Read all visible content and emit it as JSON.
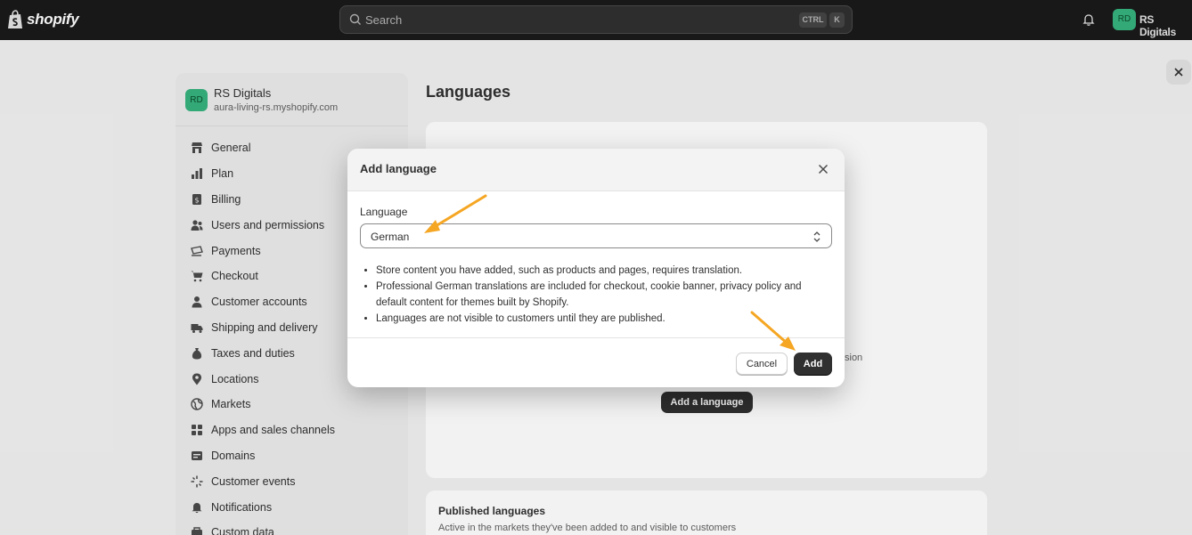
{
  "topbar": {
    "brand": "shopify",
    "search_placeholder": "Search",
    "shortcut_ctrl": "CTRL",
    "shortcut_key": "K",
    "avatar_initials": "RD",
    "store_name": "RS Digitals"
  },
  "sidebar": {
    "avatar_initials": "RD",
    "store_name": "RS Digitals",
    "store_domain": "aura-living-rs.myshopify.com",
    "items": [
      {
        "label": "General",
        "icon": "store-icon"
      },
      {
        "label": "Plan",
        "icon": "chart-icon"
      },
      {
        "label": "Billing",
        "icon": "billing-icon"
      },
      {
        "label": "Users and permissions",
        "icon": "users-icon"
      },
      {
        "label": "Payments",
        "icon": "payments-icon"
      },
      {
        "label": "Checkout",
        "icon": "cart-icon"
      },
      {
        "label": "Customer accounts",
        "icon": "person-icon"
      },
      {
        "label": "Shipping and delivery",
        "icon": "truck-icon"
      },
      {
        "label": "Taxes and duties",
        "icon": "tax-icon"
      },
      {
        "label": "Locations",
        "icon": "pin-icon"
      },
      {
        "label": "Markets",
        "icon": "globe-icon"
      },
      {
        "label": "Apps and sales channels",
        "icon": "apps-icon"
      },
      {
        "label": "Domains",
        "icon": "domain-icon"
      },
      {
        "label": "Customer events",
        "icon": "sparkle-icon"
      },
      {
        "label": "Notifications",
        "icon": "bell-icon"
      },
      {
        "label": "Custom data",
        "icon": "data-icon"
      }
    ]
  },
  "main": {
    "title": "Languages",
    "card_text_fragment": "sion",
    "add_language_button": "Add a language",
    "published_title": "Published languages",
    "published_subtitle": "Active in the markets they've been added to and visible to customers"
  },
  "modal": {
    "title": "Add language",
    "field_label": "Language",
    "selected_language": "German",
    "bullets": [
      "Store content you have added, such as products and pages, requires translation.",
      "Professional German translations are included for checkout, cookie banner, privacy policy and default content for themes built by Shopify.",
      "Languages are not visible to customers until they are published."
    ],
    "cancel_label": "Cancel",
    "add_label": "Add"
  },
  "colors": {
    "topbar": "#1a1a1a",
    "avatar": "#36b37e",
    "primary_button": "#303030",
    "annotation_arrow": "#f5a623"
  }
}
